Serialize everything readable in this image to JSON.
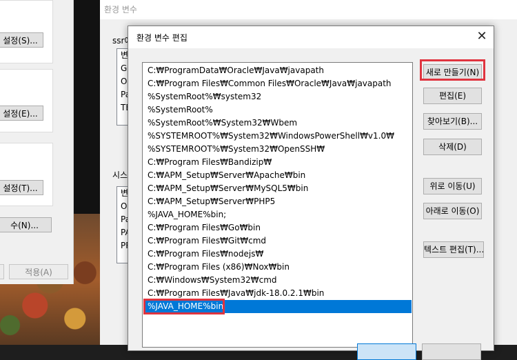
{
  "left_window": {
    "buttons": [
      {
        "label": "설정(S)..."
      },
      {
        "label": "설정(E)..."
      },
      {
        "label": "설정(T)..."
      },
      {
        "label": "수(N)..."
      },
      {
        "label": ""
      },
      {
        "label": "적용(A)"
      }
    ]
  },
  "env_window": {
    "title": "환경 변수",
    "user_section_label": "ssr에",
    "user_vars": [
      "변",
      "GO",
      "Or",
      "Pa",
      "TE"
    ],
    "system_section_label": "시스",
    "system_vars": [
      "변",
      "OS",
      "Pa",
      "PA",
      "PR"
    ]
  },
  "dialog": {
    "title": "환경 변수 편집",
    "close_glyph": "✕",
    "paths": [
      "C:₩ProgramData₩Oracle₩Java₩javapath",
      "C:₩Program Files₩Common Files₩Oracle₩Java₩javapath",
      "%SystemRoot%₩system32",
      "%SystemRoot%",
      "%SystemRoot%₩System32₩Wbem",
      "%SYSTEMROOT%₩System32₩WindowsPowerShell₩v1.0₩",
      "%SYSTEMROOT%₩System32₩OpenSSH₩",
      "C:₩Program Files₩Bandizip₩",
      "C:₩APM_Setup₩Server₩Apache₩bin",
      "C:₩APM_Setup₩Server₩MySQL5₩bin",
      "C:₩APM_Setup₩Server₩PHP5",
      "%JAVA_HOME%bin;",
      "C:₩Program Files₩Go₩bin",
      "C:₩Program Files₩Git₩cmd",
      "C:₩Program Files₩nodejs₩",
      "C:₩Program Files (x86)₩Nox₩bin",
      "C:₩Windows₩System32₩cmd",
      "C:₩Program Files₩Java₩jdk-18.0.2.1₩bin",
      "%JAVA_HOME%bin"
    ],
    "selected_index": 18,
    "buttons": {
      "new": "새로 만들기(N)",
      "edit": "편집(E)",
      "browse": "찾아보기(B)...",
      "delete": "삭제(D)",
      "move_up": "위로 이동(U)",
      "move_down": "아래로 이동(O)",
      "edit_text": "텍스트 편집(T)..."
    },
    "colors": {
      "highlight": "#e0343f",
      "selection": "#0078d7"
    }
  }
}
